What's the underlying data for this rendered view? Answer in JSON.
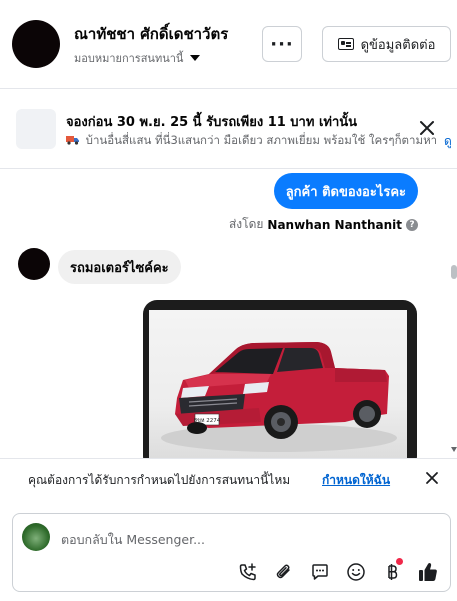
{
  "header": {
    "contact_name": "ณาทัชชา ศักดิ์เดชาวัตร",
    "assign_label": "มอบหมายการสนทนานี้",
    "more_label": "···",
    "contact_info_label": "ดูข้อมูลติดต่อ"
  },
  "ad_banner": {
    "title": "จองก่อน 30 พ.ย. 25 นี้ รับรถเพียง 11 บาท เท่านั้น",
    "description": "บ้านอื่นสี่แสน ที่นี่3แสนกว่า มือเดียว สภาพเยี่ยม พร้อมใช้ ใครๆก็ตามหา ...",
    "link_label": "ดู"
  },
  "messages": {
    "outgoing_text": "ลูกค้า ติดของอะไรคะ",
    "sent_by_prefix": "ส่งโดย",
    "sent_by_name": "Nanwhan Nanthanit",
    "incoming_text": "รถมอเตอร์ไซค์คะ",
    "license_plate": "8ขห 2274"
  },
  "label_bar": {
    "prompt": "คุณต้องการได้รับการกำหนดไปยังการสนทนานี้ไหม",
    "action_label": "กำหนดให้ฉัน"
  },
  "composer": {
    "placeholder": "ตอบกลับใน Messenger..."
  },
  "icons": {
    "more": "more-dots-icon",
    "contact": "contact-card-icon",
    "close": "close-icon",
    "help": "help-icon",
    "call": "call-add-icon",
    "attach": "paperclip-icon",
    "saved_replies": "chat-bubble-icon",
    "emoji": "smiley-icon",
    "payment": "baht-icon",
    "like": "thumbs-up-icon"
  },
  "colors": {
    "accent": "#0a7cff",
    "link": "#0064d1",
    "notification_dot": "#f02849",
    "car_red": "#c41e3a"
  }
}
